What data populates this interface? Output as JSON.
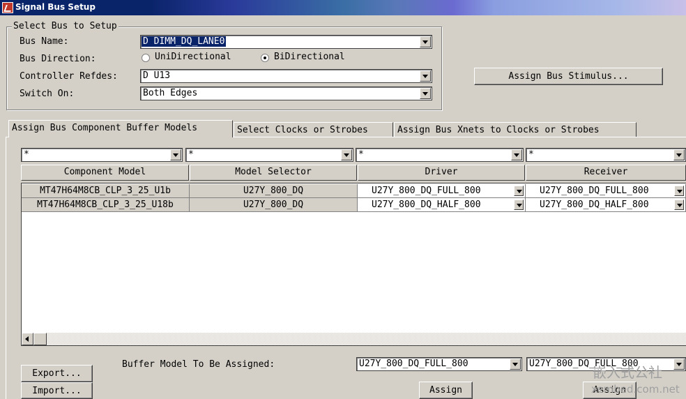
{
  "window": {
    "title": "Signal Bus Setup"
  },
  "select_bus": {
    "legend": "Select Bus to Setup",
    "bus_name_label": "Bus Name:",
    "bus_name_value": "D DIMM_DQ_LANE0",
    "direction_label": "Bus Direction:",
    "direction_options": [
      "UniDirectional",
      "BiDirectional"
    ],
    "direction_selected": "BiDirectional",
    "controller_label": "Controller Refdes:",
    "controller_value": "D U13",
    "switch_label": "Switch On:",
    "switch_value": "Both Edges"
  },
  "assign_stimulus_button": "Assign Bus Stimulus...",
  "tabs": [
    {
      "label": "Assign Bus Component Buffer Models",
      "active": true
    },
    {
      "label": "Select Clocks or Strobes",
      "active": false
    },
    {
      "label": "Assign Bus Xnets to Clocks or Strobes",
      "active": false
    }
  ],
  "filters": [
    "*",
    "*",
    "*",
    "*"
  ],
  "columns": [
    "Component Model",
    "Model Selector",
    "Driver",
    "Receiver"
  ],
  "rows": [
    {
      "component": "MT47H64M8CB_CLP_3_25_U1b",
      "selector": "U27Y_800_DQ",
      "driver": "U27Y_800_DQ_FULL_800",
      "receiver": "U27Y_800_DQ_FULL_800"
    },
    {
      "component": "MT47H64M8CB_CLP_3_25_U18b",
      "selector": "U27Y_800_DQ",
      "driver": "U27Y_800_DQ_HALF_800",
      "receiver": "U27Y_800_DQ_HALF_800"
    }
  ],
  "bottom": {
    "export_label": "Export...",
    "import_label": "Import...",
    "buffer_label": "Buffer Model To Be Assigned:",
    "driver_value": "U27Y_800_DQ_FULL_800",
    "receiver_value": "U27Y_800_DQ_FULL_800",
    "assign_label": "Assign",
    "assign2_label": "Assign"
  },
  "watermark": {
    "line1": "嵌入式公社",
    "line2": "xembed.com.net"
  }
}
